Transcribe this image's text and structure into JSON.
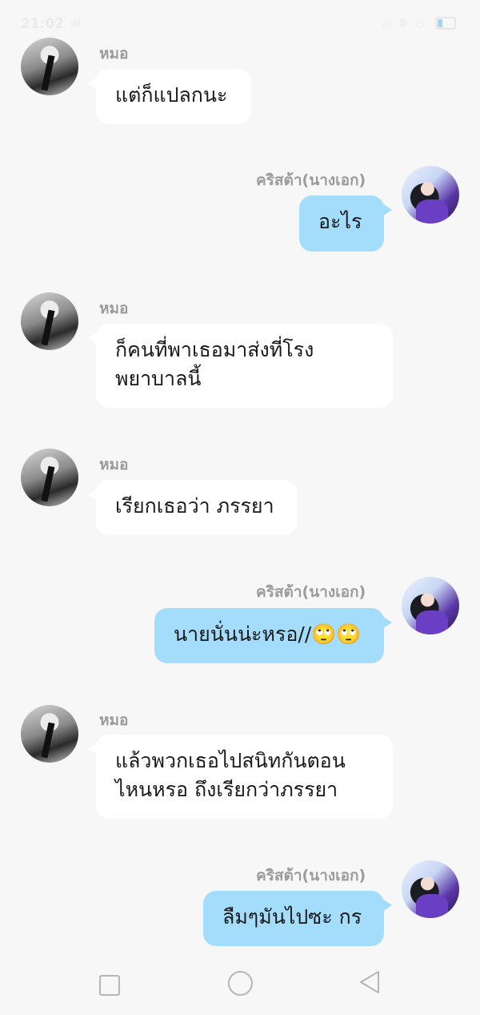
{
  "status_bar": {
    "time": "21:02",
    "signal": "ıll",
    "right_icons": "◎ ⊙ ◷",
    "battery_level": 0.3
  },
  "contacts": {
    "doctor": "หมอ",
    "heroine": "คริสต้า(นางเอก)"
  },
  "messages": [
    {
      "sender": "หมอ",
      "side": "left",
      "text": "แต่ก็แปลกนะ"
    },
    {
      "sender": "คริสต้า(นางเอก)",
      "side": "right",
      "text": "อะไร"
    },
    {
      "sender": "หมอ",
      "side": "left",
      "text": "ก็คนที่พาเธอมาส่งที่โรง\nพยาบาลนี้"
    },
    {
      "sender": "หมอ",
      "side": "left",
      "text": "เรียกเธอว่า ภรรยา"
    },
    {
      "sender": "คริสต้า(นางเอก)",
      "side": "right",
      "text": "นายนั่นน่ะหรอ//🙄🙄"
    },
    {
      "sender": "หมอ",
      "side": "left",
      "text": "แล้วพวกเธอไปสนิทกันตอน\nไหนหรอ ถึงเรียกว่าภรรยา"
    },
    {
      "sender": "คริสต้า(นางเอก)",
      "side": "right",
      "text": "ลืมๆมันไปซะ กร"
    }
  ],
  "colors": {
    "background": "#f7f7f7",
    "incoming_bubble": "#ffffff",
    "outgoing_bubble": "#a4dcfb",
    "name_text": "#9b9b9b"
  },
  "icons": {
    "recents": "square-icon",
    "home": "circle-icon",
    "back": "triangle-back-icon"
  }
}
